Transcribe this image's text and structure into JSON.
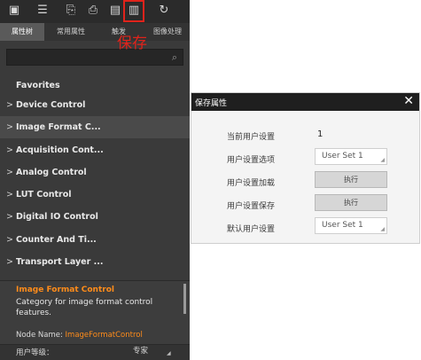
{
  "tabs": {
    "properties": "属性树",
    "common": "常用属性",
    "trigger": "触发",
    "image_processing": "图像处理"
  },
  "callout": {
    "save_text": "保存"
  },
  "tree": [
    {
      "label": "Favorites",
      "chevron": ""
    },
    {
      "label": "Device Control",
      "chevron": ">"
    },
    {
      "label": "Image Format C...",
      "chevron": ">"
    },
    {
      "label": "Acquisition Cont...",
      "chevron": ">"
    },
    {
      "label": "Analog Control",
      "chevron": ">"
    },
    {
      "label": "LUT Control",
      "chevron": ">"
    },
    {
      "label": "Digital IO Control",
      "chevron": ">"
    },
    {
      "label": "Counter And Ti...",
      "chevron": ">"
    },
    {
      "label": "Transport Layer ...",
      "chevron": ">"
    }
  ],
  "description": {
    "title": "Image Format Control",
    "text": "Category for image format control features.",
    "node_name_label": "Node Name: ",
    "node_name_value": "ImageFormatControl"
  },
  "user_level": {
    "label": "用户等级：",
    "value": "专家"
  },
  "dialog": {
    "title": "保存属性",
    "close": "✕",
    "current_user_setting_label": "当前用户设置",
    "current_user_setting_value": "1",
    "user_setting_option_label": "用户设置选项",
    "user_setting_option_value": "User Set 1",
    "user_setting_load_label": "用户设置加载",
    "user_setting_save_label": "用户设置保存",
    "execute_label": "执行",
    "default_user_setting_label": "默认用户设置",
    "default_user_setting_value": "User Set 1"
  }
}
